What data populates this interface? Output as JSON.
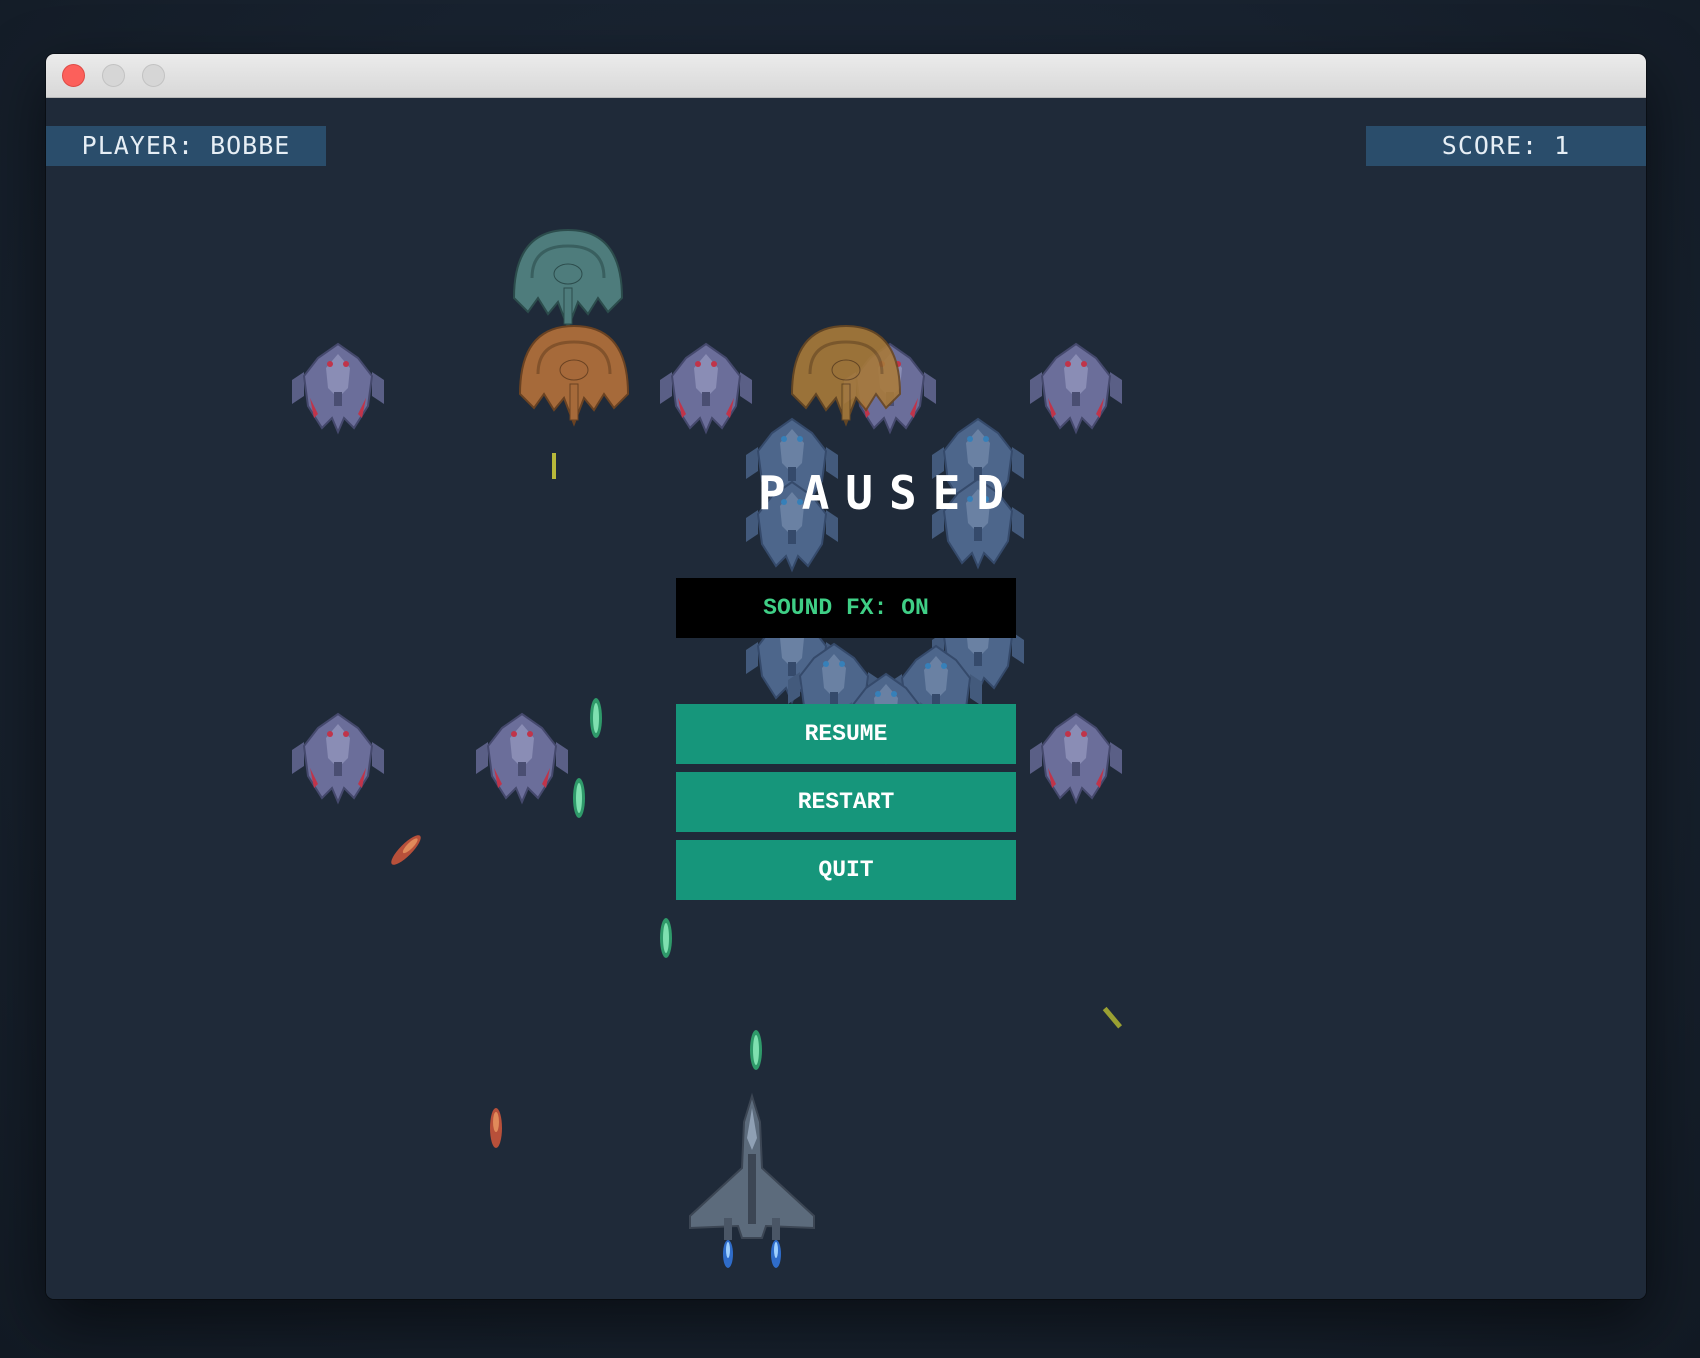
{
  "window": {
    "controls": [
      "close",
      "minimize",
      "zoom"
    ]
  },
  "hud": {
    "player_label": "PLAYER: BOBBE",
    "score_label": "SCORE: 1"
  },
  "pause_menu": {
    "title": "PAUSED",
    "sound_toggle": "SOUND FX: ON",
    "buttons": {
      "resume": "RESUME",
      "restart": "RESTART",
      "quit": "QUIT"
    }
  },
  "colors": {
    "game_background": "#1f2a39",
    "hud_background": "#2a4d6b",
    "button_teal": "#16967b",
    "sound_text_green": "#3fcf86",
    "close_red": "#fc605b"
  },
  "sprites": {
    "enemy_fighter_icon": "alien-fighter-ship",
    "enemy_dome_icon": "alien-dome-ship",
    "player_icon": "player-jet-ship",
    "player_bullet_icon": "green-plasma-bolt",
    "enemy_missile_icon": "red-missile"
  }
}
